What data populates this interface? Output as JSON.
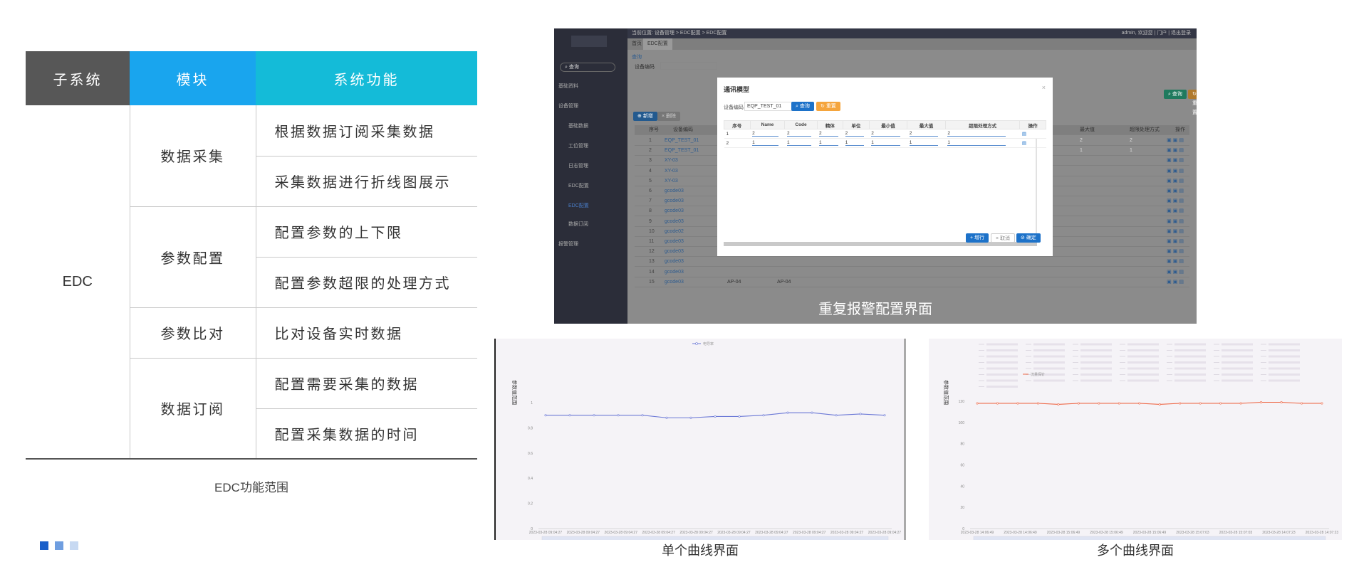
{
  "table": {
    "headers": [
      "子系统",
      "模块",
      "系统功能"
    ],
    "subsystem": "EDC",
    "modules": [
      {
        "name": "数据采集",
        "functions": [
          "根据数据订阅采集数据",
          "采集数据进行折线图展示"
        ]
      },
      {
        "name": "参数配置",
        "functions": [
          "配置参数的上下限",
          "配置参数超限的处理方式"
        ]
      },
      {
        "name": "参数比对",
        "functions": [
          "比对设备实时数据"
        ]
      },
      {
        "name": "数据订阅",
        "functions": [
          "配置需要采集的数据",
          "配置采集数据的时间"
        ]
      }
    ],
    "caption": "EDC功能范围"
  },
  "captions": {
    "alarm": "重复报警配置界面",
    "single": "单个曲线界面",
    "multi": "多个曲线界面"
  },
  "squares": [
    "#1a5fc9",
    "#6f9ee0",
    "#c7d9f2"
  ],
  "alarm_screen": {
    "breadcrumb": "当前位置: 设备管理 > EDC配置 > EDC配置",
    "user": "admin, 欢迎您 | 门户 | 退出登录",
    "tabs": [
      "首页",
      "EDC配置"
    ],
    "search_placeholder": "查询",
    "nav": [
      {
        "label": "基础资料",
        "sub": false,
        "active": false
      },
      {
        "label": "设备管理",
        "sub": false,
        "active": false
      },
      {
        "label": "基础数据",
        "sub": true,
        "active": false
      },
      {
        "label": "工位管理",
        "sub": true,
        "active": false
      },
      {
        "label": "日志管理",
        "sub": true,
        "active": false
      },
      {
        "label": "EDC配置",
        "sub": true,
        "active": false
      },
      {
        "label": "EDC配置",
        "sub": true,
        "active": true
      },
      {
        "label": "数据订阅",
        "sub": true,
        "active": false
      },
      {
        "label": "报警管理",
        "sub": false,
        "active": false
      }
    ],
    "query_label": "查询",
    "equipment_code_label": "设备编码",
    "add_button": "新增",
    "delete_button": "删除",
    "search_button": "查询",
    "reset_button": "重置",
    "grid_headers": [
      "序号",
      "设备编码",
      "最大值",
      "超限处理方式",
      "操作"
    ],
    "grid_rows": [
      {
        "id": "1",
        "code": "EQP_TEST_01",
        "max": "2",
        "mode": "2"
      },
      {
        "id": "2",
        "code": "EQP_TEST_01",
        "max": "1",
        "mode": "1"
      },
      {
        "id": "3",
        "code": "XY-03",
        "max": "",
        "mode": ""
      },
      {
        "id": "4",
        "code": "XY-03",
        "max": "",
        "mode": ""
      },
      {
        "id": "5",
        "code": "XY-03",
        "max": "",
        "mode": ""
      },
      {
        "id": "6",
        "code": "gcode03",
        "max": "",
        "mode": ""
      },
      {
        "id": "7",
        "code": "gcode03",
        "max": "",
        "mode": ""
      },
      {
        "id": "8",
        "code": "gcode03",
        "max": "",
        "mode": ""
      },
      {
        "id": "9",
        "code": "gcode03",
        "max": "",
        "mode": ""
      },
      {
        "id": "10",
        "code": "gcode02",
        "max": "",
        "mode": ""
      },
      {
        "id": "11",
        "code": "gcode03",
        "max": "",
        "mode": ""
      },
      {
        "id": "12",
        "code": "gcode03",
        "max": "",
        "mode": ""
      },
      {
        "id": "13",
        "code": "gcode03",
        "max": "",
        "mode": ""
      },
      {
        "id": "14",
        "code": "gcode03",
        "max": "",
        "mode": ""
      },
      {
        "id": "15",
        "code": "gcode03",
        "max": "AP-04",
        "mode": "AP-04"
      }
    ],
    "modal": {
      "title": "通讯模型",
      "close": "×",
      "field_label": "设备编码",
      "field_value": "EQP_TEST_01",
      "search_button": "查询",
      "reset_button": "重置",
      "headers": [
        "序号",
        "Name",
        "Code",
        "精体",
        "单位",
        "最小值",
        "最大值",
        "超限处理方式",
        "操作"
      ],
      "rows": [
        [
          "1",
          "2",
          "2",
          "2",
          "2",
          "2",
          "2",
          "2"
        ],
        [
          "2",
          "1",
          "1",
          "1",
          "1",
          "1",
          "1",
          "1"
        ]
      ],
      "add_row_button": "+ 增行",
      "cancel_button": "× 取消",
      "confirm_button": "确定"
    }
  },
  "chart_data": [
    {
      "type": "line",
      "title": "",
      "legend": [
        "电导率"
      ],
      "legend_position": "top-center",
      "ylabel": "参数值范围",
      "xlabel": "",
      "ylim": [
        0,
        1
      ],
      "yticks": [
        "0",
        "0.2",
        "0.4",
        "0.6",
        "0.8",
        "1"
      ],
      "x": [
        "2023-03-28 09:04:27",
        "2023-03-28 09:04:27",
        "2023-03-28 09:04:27",
        "2023-03-28 09:04:27",
        "2023-03-28 09:04:27",
        "2023-03-28 09:04:27",
        "2023-03-28 09:04:27",
        "2023-03-28 09:04:27",
        "2023-03-28 09:04:27",
        "2023-03-28 09:04:27"
      ],
      "series": [
        {
          "name": "电导率",
          "color": "#6b78d6",
          "values": [
            0.9,
            0.9,
            0.9,
            0.9,
            0.9,
            0.88,
            0.88,
            0.89,
            0.89,
            0.9,
            0.92,
            0.92,
            0.9,
            0.91,
            0.9
          ]
        }
      ],
      "grid": false
    },
    {
      "type": "line",
      "title": "",
      "legend_position": "top-left",
      "highlighted_series": "流量探针",
      "ylabel": "参数值范围",
      "xlabel": "",
      "ylim": [
        0,
        120
      ],
      "yticks": [
        "0",
        "20",
        "40",
        "60",
        "80",
        "100",
        "120"
      ],
      "x": [
        "2023-03-28 14:06:49",
        "2023-03-28 14:06:49",
        "2023-03-28 15:06:49",
        "2023-03-28 15:06:49",
        "2023-03-28 15:06:49",
        "2023-03-28 15:07:03",
        "2023-03-28 15:07:03",
        "2023-03-28 14:07:23",
        "2023-03-28 14:07:23"
      ],
      "series": [
        {
          "name": "流量探针",
          "color": "#ee6a4a",
          "values": [
            118,
            118,
            118,
            118,
            117,
            118,
            118,
            118,
            118,
            117,
            118,
            118,
            118,
            118,
            119,
            119,
            118,
            118
          ]
        }
      ],
      "grid": false
    }
  ]
}
